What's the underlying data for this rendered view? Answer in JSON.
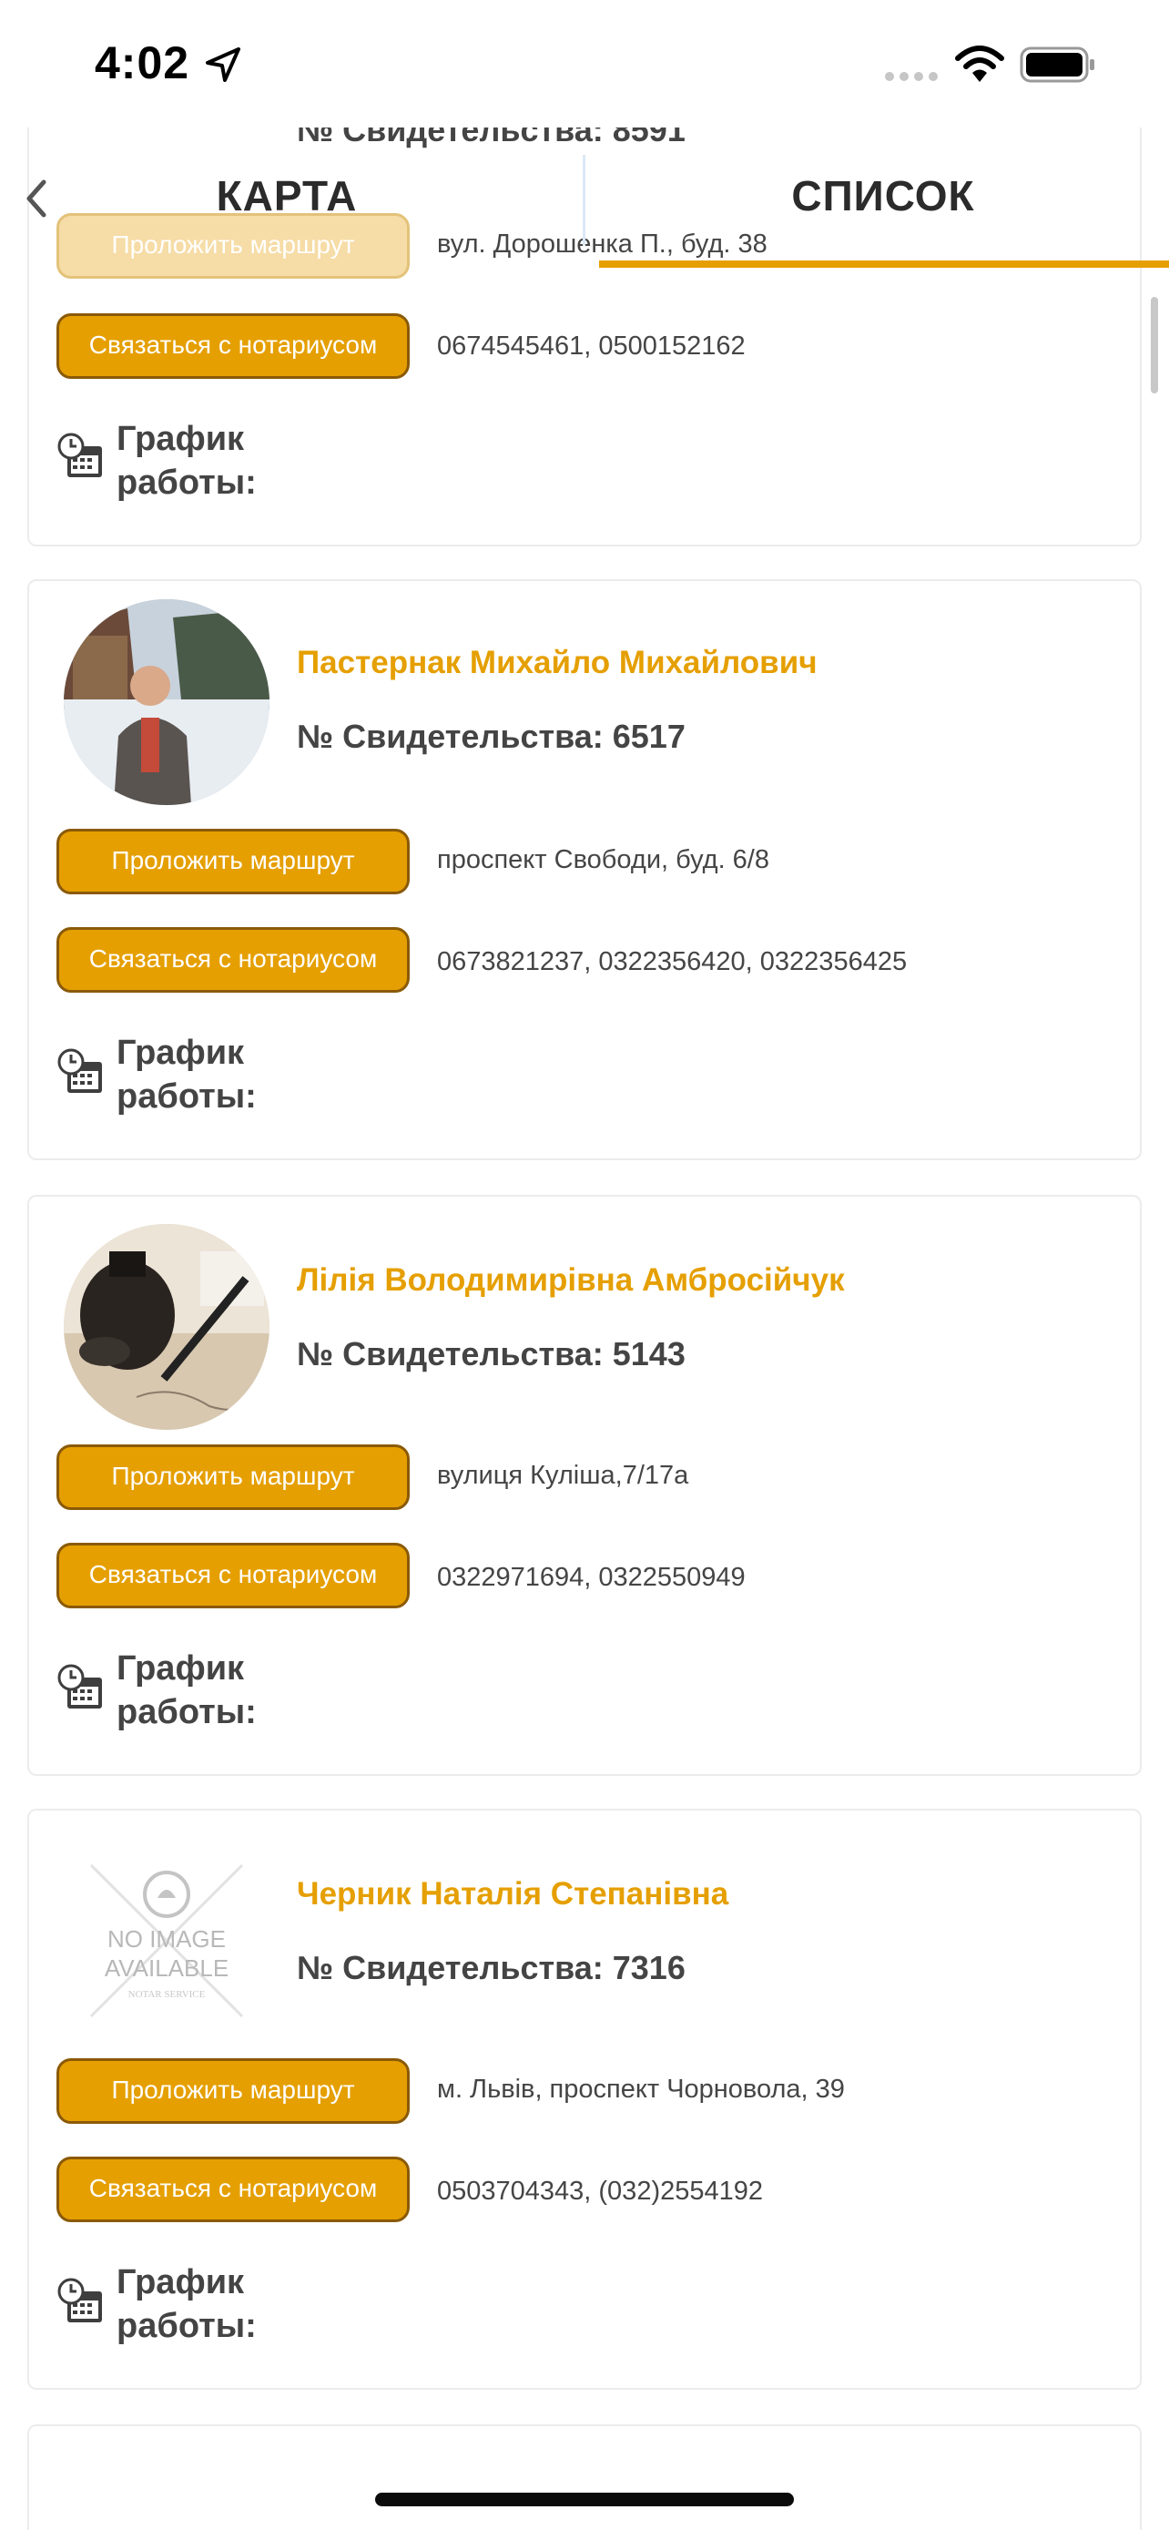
{
  "status_bar": {
    "time": "4:02"
  },
  "tabs": {
    "map_label": "КАРТА",
    "list_label": "СПИСОК",
    "accent_color": "#e59f00"
  },
  "cards": [
    {
      "cert": "№ Свидетельства: 8591",
      "route_label": "Проложить маршрут",
      "address": "вул. Дорошенка П., буд. 38",
      "contact_label": "Связаться с нотариусом",
      "phones": "0674545461, 0500152162",
      "schedule_label": "График",
      "schedule_label2": "работы:"
    },
    {
      "name": "Пастернак Михайло Михайлович",
      "cert": "№ Свидетельства: 6517",
      "route_label": "Проложить маршрут",
      "address": "проспект Свободи, буд. 6/8",
      "contact_label": "Связаться с нотариусом",
      "phones": "0673821237, 0322356420, 0322356425",
      "schedule_label": "График",
      "schedule_label2": "работы:"
    },
    {
      "name": "Лілія Володимирівна Амбросійчук",
      "cert": "№ Свидетельства: 5143",
      "route_label": "Проложить маршрут",
      "address": "вулиця Куліша,7/17а",
      "contact_label": "Связаться с нотариусом",
      "phones": "0322971694, 0322550949",
      "schedule_label": "График",
      "schedule_label2": "работы:"
    },
    {
      "name": "Черник Наталія Степанівна",
      "cert": "№ Свидетельства: 7316",
      "route_label": "Проложить маршрут",
      "address": "м. Львів, проспект Чорновола, 39",
      "contact_label": "Связаться с нотариусом",
      "phones": "0503704343, (032)2554192",
      "schedule_label": "График",
      "schedule_label2": "работы:",
      "placeholder_line1": "NO IMAGE",
      "placeholder_line2": "AVAILABLE",
      "placeholder_brand": "NOTAR SERVICE"
    }
  ]
}
